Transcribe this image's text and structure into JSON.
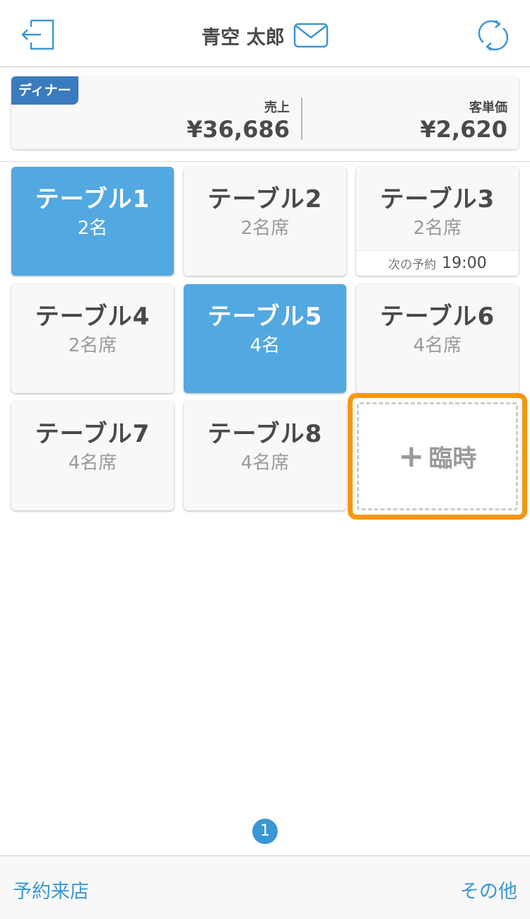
{
  "header": {
    "user_name": "青空 太郎"
  },
  "summary": {
    "badge": "ディナー",
    "sales_label": "売上",
    "sales_value": "¥36,686",
    "unit_price_label": "客単価",
    "unit_price_value": "¥2,620"
  },
  "tables": [
    {
      "name": "テーブル1",
      "seats": "2名",
      "active": true
    },
    {
      "name": "テーブル2",
      "seats": "2名席",
      "active": false
    },
    {
      "name": "テーブル3",
      "seats": "2名席",
      "active": false,
      "reservation_label": "次の予約",
      "reservation_time": "19:00"
    },
    {
      "name": "テーブル4",
      "seats": "2名席",
      "active": false
    },
    {
      "name": "テーブル5",
      "seats": "4名",
      "active": true
    },
    {
      "name": "テーブル6",
      "seats": "4名席",
      "active": false
    },
    {
      "name": "テーブル7",
      "seats": "4名席",
      "active": false
    },
    {
      "name": "テーブル8",
      "seats": "4名席",
      "active": false
    }
  ],
  "temp_add": {
    "plus": "+",
    "label": "臨時"
  },
  "pagination": {
    "current_page": "1"
  },
  "footer": {
    "left_label": "予約来店",
    "right_label": "その他"
  },
  "colors": {
    "accent": "#3a97d4",
    "active_tile": "#52a8e0",
    "badge": "#3a7bbf",
    "highlight": "#f7960d"
  },
  "icons": {
    "logout": "logout-icon",
    "mail": "mail-icon",
    "refresh": "refresh-icon"
  }
}
